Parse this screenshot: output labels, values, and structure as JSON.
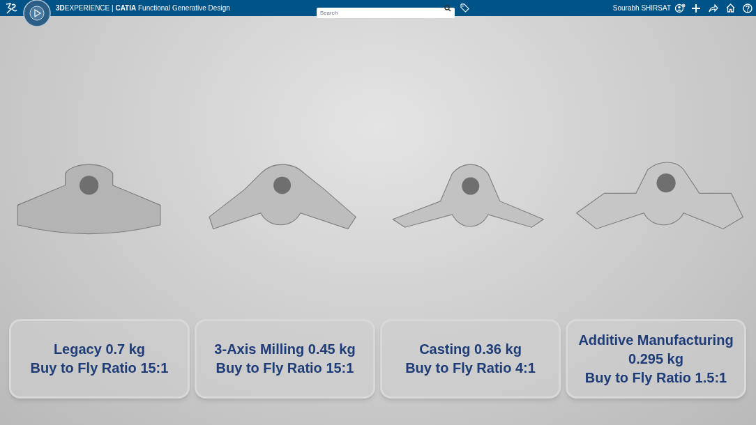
{
  "topbar": {
    "title": "**3D**EXPERIENCE | **CATIA** Functional Generative Design",
    "search": {
      "placeholder": "Search"
    },
    "user": "Sourabh SHIRSAT"
  },
  "parts": [
    {
      "kind": "legacy"
    },
    {
      "kind": "milled"
    },
    {
      "kind": "cast"
    },
    {
      "kind": "additive"
    }
  ],
  "cards": [
    {
      "lines": [
        "Legacy 0.7 kg",
        "Buy to Fly Ratio 15:1"
      ]
    },
    {
      "lines": [
        "3-Axis Milling 0.45 kg",
        "Buy to Fly Ratio 15:1"
      ]
    },
    {
      "lines": [
        "Casting 0.36 kg",
        "Buy to Fly Ratio 4:1"
      ]
    },
    {
      "lines": [
        "Additive Manufacturing",
        "0.295 kg",
        "Buy to Fly Ratio 1.5:1"
      ]
    }
  ]
}
